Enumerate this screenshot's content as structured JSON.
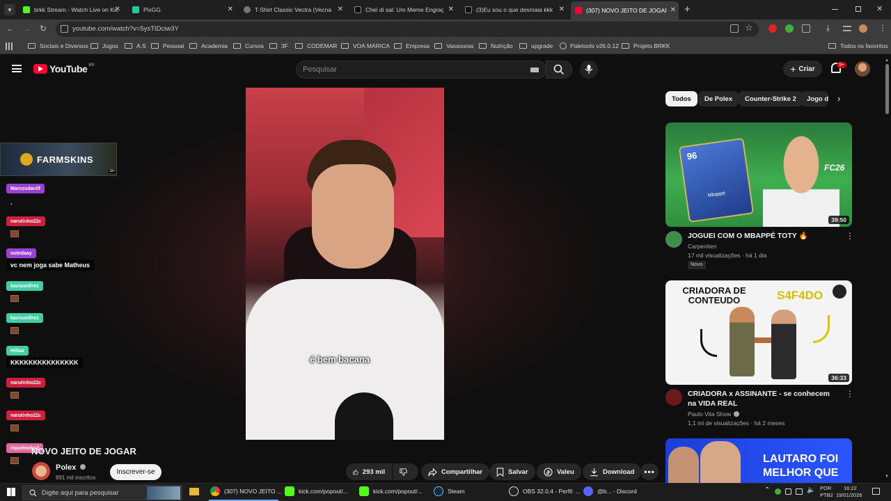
{
  "browser": {
    "tabs": [
      {
        "title": "brkk Stream - Watch Live on Kic",
        "active": false
      },
      {
        "title": "PixGG",
        "active": false
      },
      {
        "title": "T-Shirt Classic Vectra (Vecna) em",
        "active": false
      },
      {
        "title": "Chei di sal: Um Meme Engraçado",
        "active": false
      },
      {
        "title": "(3)Eu sou o que desmaia kkk se",
        "active": false
      },
      {
        "title": "(307) NOVO JEITO DE JOGAR -",
        "active": true
      }
    ],
    "new_tab_label": "+",
    "url": "youtube.com/watch?v=5ysTIDciw3Y",
    "bookmarks": [
      "Sociais e Diversos",
      "Jogos",
      "A.S",
      "Pessoal",
      "Academia",
      "Cursos",
      "3F",
      "CODEMAR",
      "VOA MARICA",
      "Empresa",
      "Vassouras",
      "Nutrição",
      "upgrade",
      "Paletools v26.0.12",
      "Projeto BRKK"
    ],
    "all_bookmarks_label": "Todos os favoritos"
  },
  "youtube": {
    "logo_text": "YouTube",
    "logo_country": "BR",
    "search_placeholder": "Pesquisar",
    "create_label": "Criar",
    "notif_count": "9+"
  },
  "video": {
    "caption": "é bem bacana",
    "title": "NOVO JEITO DE JOGAR",
    "channel": "Polex",
    "subscribers": "891 mil inscritos",
    "subscribe_label": "Inscrever-se",
    "likes": "293 mil",
    "share_label": "Compartilhar",
    "save_label": "Salvar",
    "thanks_label": "Valeu",
    "download_label": "Download"
  },
  "chat": {
    "banner_text": "FARMSKINS",
    "banner_badge": "18+",
    "messages": [
      {
        "user": "Marcosdavilf",
        "color": "#9b3fd9",
        "text": "."
      },
      {
        "user": "narutinho22c",
        "color": "#d01e3c",
        "text": ""
      },
      {
        "user": "notedaay",
        "color": "#9b3fd9",
        "text": "vc nem joga sabe Matheus"
      },
      {
        "user": "kavisonfire1",
        "color": "#3fcfa6",
        "text": ""
      },
      {
        "user": "kavisonfire1",
        "color": "#3fcfa6",
        "text": ""
      },
      {
        "user": "Hilkaz",
        "color": "#3fcfa6",
        "text": "KKKKKKKKKKKKKKK"
      },
      {
        "user": "narutinho22c",
        "color": "#d01e3c",
        "text": ""
      },
      {
        "user": "narutinho22c",
        "color": "#d01e3c",
        "text": ""
      },
      {
        "user": "riquelmebx2",
        "color": "#e06a9b",
        "text": ""
      }
    ]
  },
  "filters": [
    "Todos",
    "De Polex",
    "Counter-Strike 2",
    "Jogo d"
  ],
  "recommendations": [
    {
      "title": "JOGUEI COM O MBAPPÉ TOTY 🔥",
      "channel": "Carpentieri",
      "meta": "17 mil visualizações · há 1 dia",
      "badge": "Novo",
      "duration": "39:50",
      "thumb_text": "96",
      "thumb_sub": "Mbappé",
      "thumb_logo": "FC26"
    },
    {
      "title": "CRIADORA x ASSINANTE - se conhecem na VIDA REAL",
      "channel": "Paulo Vita Show",
      "meta": "1,1 mi de visualizações · há 2 meses",
      "duration": "36:33",
      "thumb_left": "CRIADORA DE CONTEUDO",
      "thumb_right": "S4F4DO"
    },
    {
      "thumb_text": "LAUTARO FOI MELHOR QUE"
    }
  ],
  "taskbar": {
    "search_placeholder": "Digite aqui para pesquisar",
    "items": [
      "(307) NOVO JEITO ...",
      "kick.com/popout/...",
      "kick.com/popout/...",
      "Steam",
      "OBS 32.0.4 - Perfil: ...",
      "@b... - Discord"
    ],
    "lang": "POR",
    "lang2": "PTB2",
    "time": "16:22",
    "date": "19/01/2026"
  }
}
